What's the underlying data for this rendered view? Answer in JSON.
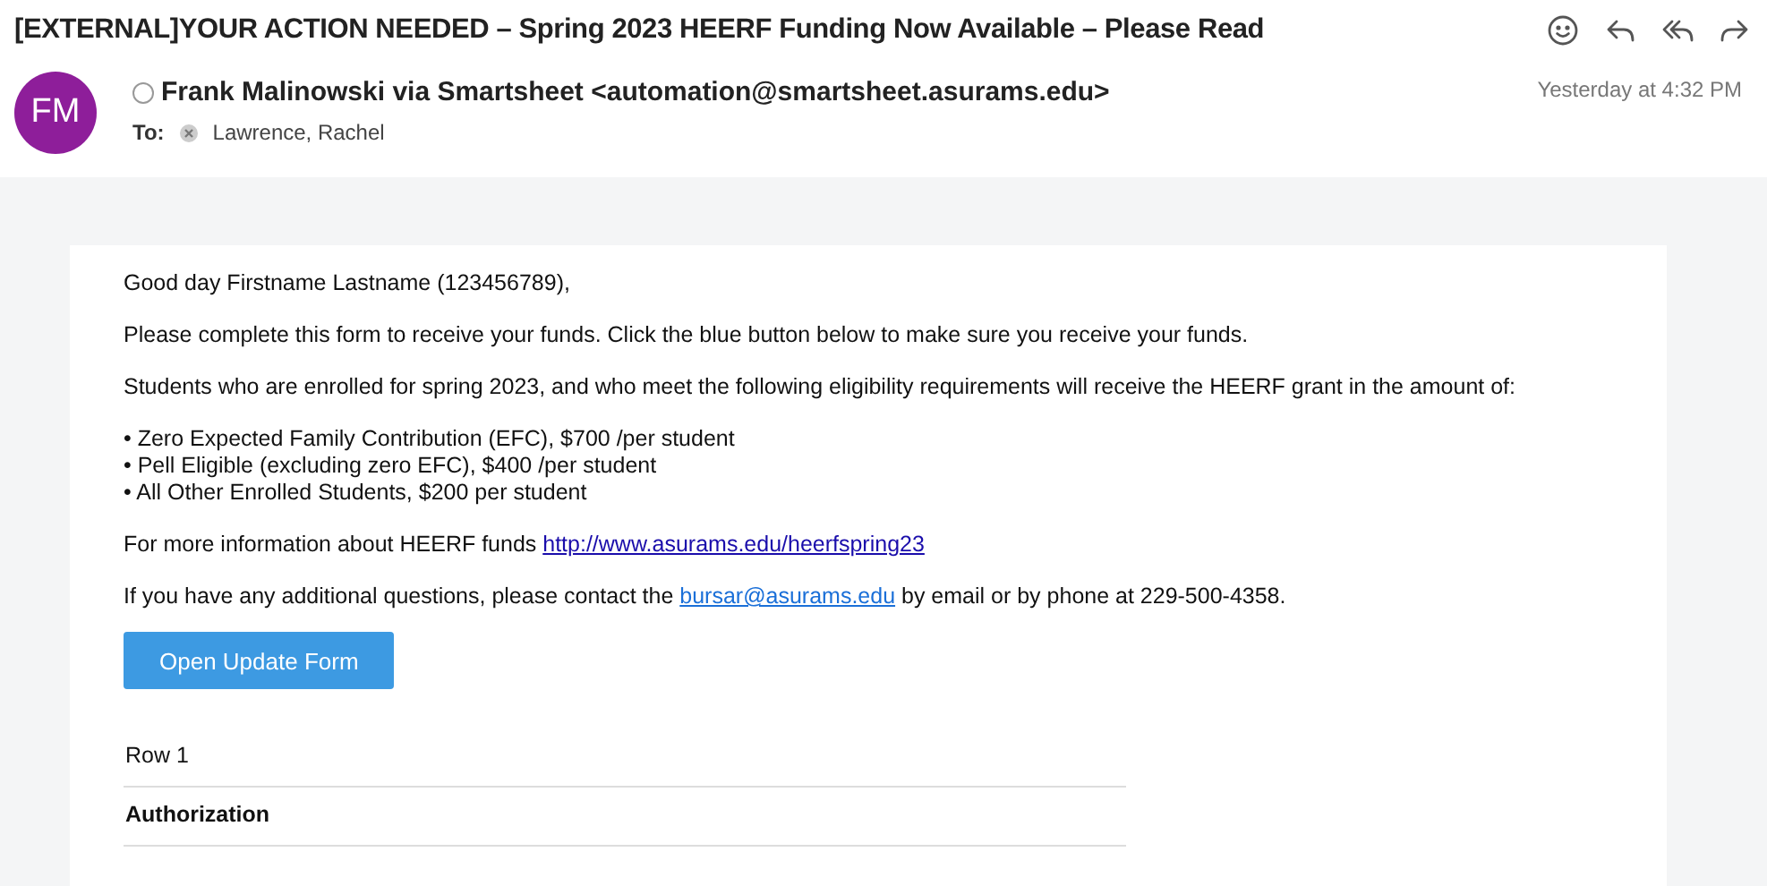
{
  "subject": "[EXTERNAL]YOUR ACTION NEEDED – Spring 2023 HEERF Funding Now Available – Please Read",
  "toolbar": [
    {
      "kind": "emoji"
    },
    {
      "kind": "reply"
    },
    {
      "kind": "reply_all"
    },
    {
      "kind": "forward"
    }
  ],
  "sender": {
    "initials": "FM",
    "name": "Frank Malinowski via Smartsheet <automation@smartsheet.asurams.edu>",
    "time": "Yesterday at 4:32 PM"
  },
  "to": {
    "label": "To:",
    "recipient": "Lawrence, Rachel"
  },
  "body": {
    "greeting": "Good day Firstname Lastname (123456789),",
    "paragraphs": [
      "Please complete this form to receive your funds. Click the blue button below to make sure you receive your funds.",
      "Students who are enrolled for spring 2023, and who meet the following eligibility requirements will receive the HEERF grant in the amount of:"
    ],
    "bullets": [
      "• Zero Expected Family Contribution (EFC), $700 /per student",
      "• Pell Eligible (excluding zero EFC), $400 /per student",
      "• All Other Enrolled Students, $200 per student"
    ],
    "info": {
      "before": "For more information about HEERF funds ",
      "link": "http://www.asurams.edu/heerfspring23"
    },
    "contact": {
      "before": "If you have any additional questions, please contact the ",
      "link": "bursar@asurams.edu",
      "after": " by email or by phone at 229-500-4358."
    },
    "button": "Open Update Form",
    "rows": [
      {
        "label": "Row 1",
        "bold": false
      },
      {
        "label": "Authorization",
        "bold": true
      }
    ]
  }
}
